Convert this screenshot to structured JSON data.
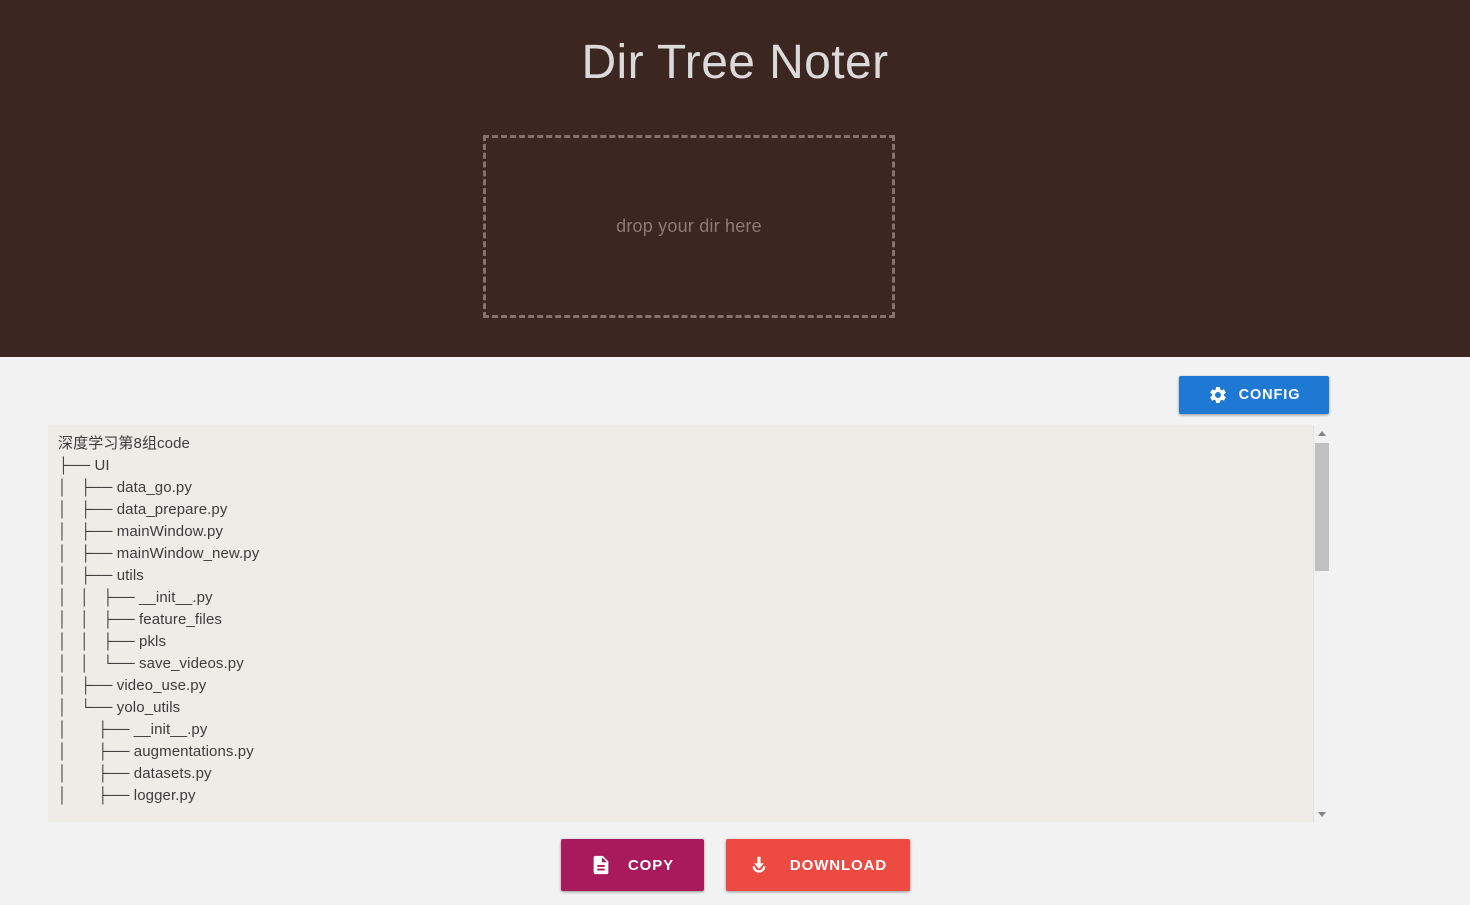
{
  "app": {
    "title": "Dir Tree Noter"
  },
  "dropzone": {
    "text": "drop your dir here"
  },
  "toolbar": {
    "config_label": "CONFIG",
    "config_icon": "gear-icon",
    "config_color": "#1e79d4"
  },
  "tree": {
    "root": "深度学习第8组code",
    "lines": [
      "深度学习第8组code",
      "├── UI",
      "│   ├── data_go.py",
      "│   ├── data_prepare.py",
      "│   ├── mainWindow.py",
      "│   ├── mainWindow_new.py",
      "│   ├── utils",
      "│   │   ├── __init__.py",
      "│   │   ├── feature_files",
      "│   │   ├── pkls",
      "│   │   └── save_videos.py",
      "│   ├── video_use.py",
      "│   └── yolo_utils",
      "│       ├── __init__.py",
      "│       ├── augmentations.py",
      "│       ├── datasets.py",
      "│       ├── logger.py"
    ],
    "background": "#efebe7",
    "text_color": "#3d3d3d"
  },
  "scrollbar": {
    "up_icon": "triangle-up-icon",
    "down_icon": "triangle-down-icon",
    "thumb_position": "near-top"
  },
  "actions": {
    "copy_label": "COPY",
    "copy_icon": "document-icon",
    "copy_color": "#a81a5b",
    "download_label": "DOWNLOAD",
    "download_icon": "download-icon",
    "download_color": "#ed4a42"
  },
  "theme": {
    "header_background": "#3b2622",
    "page_background": "#f2f2f2",
    "title_color": "#dcdad8",
    "dropzone_border": "#85726c",
    "dropzone_text": "#8d7a73"
  }
}
